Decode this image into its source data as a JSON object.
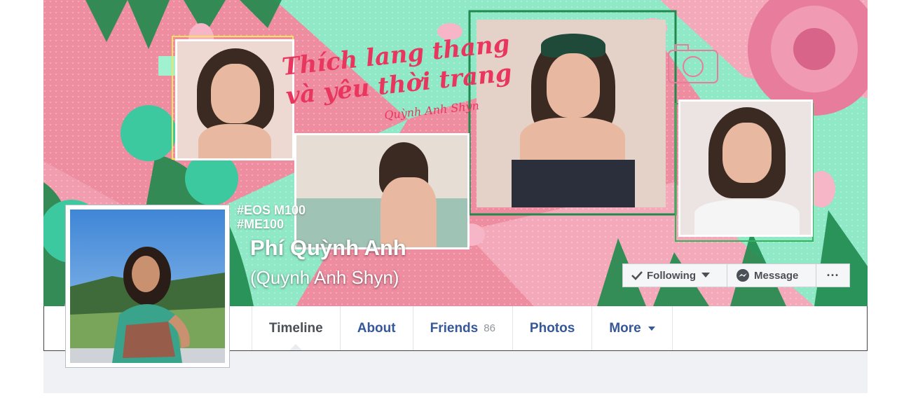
{
  "cover": {
    "quote_line1": "Thích lang thang",
    "quote_line2": "và yêu thời trang",
    "signature": "Quỳnh Anh Shyn",
    "hashtag1": "#EOS M100",
    "hashtag2": "#ME100"
  },
  "profile": {
    "name": "Phí Quỳnh Anh",
    "alternate_name": "(Quynh Anh Shyn)"
  },
  "actions": {
    "following_label": "Following",
    "message_label": "Message",
    "more_label": "···"
  },
  "nav": {
    "tabs": [
      {
        "label": "Timeline",
        "active": true
      },
      {
        "label": "About"
      },
      {
        "label": "Friends",
        "count": "86"
      },
      {
        "label": "Photos"
      },
      {
        "label": "More"
      }
    ]
  },
  "colors": {
    "link_blue": "#365899",
    "cover_mint": "#8fe8c6",
    "cover_pink": "#ee8ca0",
    "quote_red": "#e8365e"
  }
}
